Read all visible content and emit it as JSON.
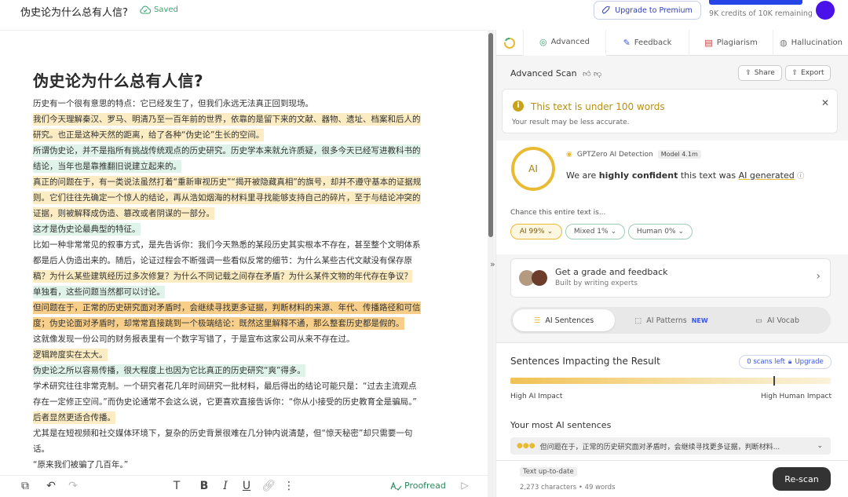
{
  "header": {
    "doc_title": "伪史论为什么总有人信?",
    "saved": "Saved",
    "upgrade": "Upgrade to Premium",
    "credits": "9K credits of 10K remaining",
    "credits_used_fraction": 0.9
  },
  "editor": {
    "heading": "伪史论为什么总有人信?",
    "lines": [
      {
        "text": "历史有一个很有意思的特点：它已经发生了，但我们永远无法真正回到现场。",
        "hl": ""
      },
      {
        "text": "我们今天理解秦汉、罗马、明清乃至一百年前的世界，依靠的是留下来的文献、器物、遗址、档案和后人的",
        "hl": "y"
      },
      {
        "text": "研究。也正是这种天然的距离，给了各种“伪史论”生长的空间。",
        "hl": "y"
      },
      {
        "text": "所谓伪史论，并不是指所有挑战传统观点的历史研究。历史学本来就允许质疑，很多今天已经写进教科书的",
        "hl": "g"
      },
      {
        "text": "结论，当年也是靠推翻旧说建立起来的。",
        "hl": "g"
      },
      {
        "text": "真正的问题在于，有一类说法虽然打着“重新审视历史”“揭开被隐藏真相”的旗号，却并不遵守基本的证据规",
        "hl": "y"
      },
      {
        "text": "则。它们往往先确定一个惊人的结论，再从浩如烟海的材料里寻找能够支持自己的碎片，至于与结论冲突的",
        "hl": "y"
      },
      {
        "text": "证据，则被解释成伪造、篡改或者阴谋的一部分。",
        "hl": "y"
      },
      {
        "text": "这才是伪史论最典型的特征。",
        "hl": "g"
      },
      {
        "text": "比如一种非常常见的叙事方式，是先告诉你：我们今天熟悉的某段历史其实根本不存在，甚至整个文明体系",
        "hl": ""
      },
      {
        "text": "都是后人伪造出来的。随后，论证过程会不断强调一些看似反常的细节：为什么某些古代文献没有保存原",
        "hl": ""
      },
      {
        "text": "稿？为什么某些建筑经历过多次修复？为什么不同记载之间存在矛盾？为什么某件文物的年代存在争议？",
        "hl": "y"
      },
      {
        "text": "单独看，这些问题当然都可以讨论。",
        "hl": "g"
      },
      {
        "text": "但问题在于，正常的历史研究面对矛盾时，会继续寻找更多证据，判断材料的来源、年代、传播路径和可信",
        "hl": "o"
      },
      {
        "text": "度；伪史论面对矛盾时，却常常直接跳到一个极端结论：既然这里解释不通，那么整套历史都是假的。",
        "hl": "o"
      },
      {
        "text": "这就像发现一份公司的财务报表里有一个数字写错了，于是宣布这家公司从来不存在过。",
        "hl": ""
      },
      {
        "text": "逻辑跨度实在太大。",
        "hl": "y"
      },
      {
        "text": "伪史论之所以容易传播，很大程度上也因为它比真正的历史研究“爽”得多。",
        "hl": "g"
      },
      {
        "text": "学术研究往往非常克制。一个研究者花几年时间研究一批材料，最后得出的结论可能只是：“过去主流观点",
        "hl": ""
      },
      {
        "text": "存在一定修正空间。”而伪史论通常不会这么说，它更喜欢直接告诉你：“你从小接受的历史教育全是骗局。”",
        "hl": ""
      },
      {
        "text": "后者显然更适合传播。",
        "hl": "y"
      },
      {
        "text": "尤其是在短视频和社交媒体环境下，复杂的历史背景很难在几分钟内说清楚，但“惊天秘密”却只需要一句",
        "hl": ""
      },
      {
        "text": "话。",
        "hl": ""
      },
      {
        "text": "“原来我们被骗了几百年。”",
        "hl": ""
      },
      {
        "text": "“西方文明史全是伪造的。”",
        "hl": ""
      }
    ],
    "proofread": "Proofread"
  },
  "panel": {
    "tabs": [
      {
        "label": "Advanced",
        "icon": "advanced-icon"
      },
      {
        "label": "Feedback",
        "icon": "feedback-icon"
      },
      {
        "label": "Plagiarism",
        "icon": "plagiarism-icon"
      },
      {
        "label": "Hallucination",
        "icon": "hallucination-icon"
      }
    ],
    "scan_title": "Advanced Scan",
    "share": "Share",
    "export": "Export",
    "warning_title": "This text is under 100 words",
    "warning_sub": "Your result may be less accurate.",
    "ai_badge": "AI",
    "detector": "GPTZero AI Detection",
    "model": "Model 4.1m",
    "confident_pre": "We are ",
    "confident_strong": "highly confident",
    "confident_mid": " this text was ",
    "confident_result": "AI generated",
    "chance_label": "Chance this entire text is...",
    "pills": [
      {
        "label": "AI 99%",
        "color": "#e9bb34"
      },
      {
        "label": "Mixed 1%",
        "color": "#a3d0b8"
      },
      {
        "label": "Human 0%",
        "color": "#8cc7a6"
      }
    ],
    "grade_title": "Get a grade and feedback",
    "grade_sub": "Built by writing experts",
    "subtabs": [
      {
        "label": "AI Sentences",
        "icon": "list-icon"
      },
      {
        "label": "AI Patterns",
        "icon": "pattern-icon",
        "badge": "NEW"
      },
      {
        "label": "AI Vocab",
        "icon": "vocab-icon"
      }
    ],
    "sentences_title": "Sentences Impacting the Result",
    "scans_left": "0 scans left",
    "upgrade_small": "Upgrade",
    "impact_marker": 0.82,
    "high_ai": "High AI Impact",
    "high_human": "High Human Impact",
    "most_ai_title": "Your most AI sentences",
    "most_ai_row": "但问题在于，正常的历史研究面对矛盾时，会继续寻找更多证据，判断材料...",
    "uptodate": "Text up-to-date",
    "counts": "2,273 characters • 49 words",
    "rescan": "Re-scan"
  }
}
